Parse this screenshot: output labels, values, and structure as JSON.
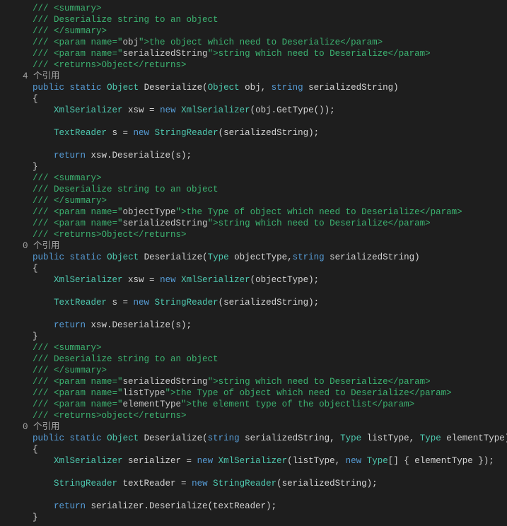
{
  "m1": {
    "c1": "/// <summary>",
    "c2": "/// Deserialize string to an object",
    "c3": "/// </summary>",
    "c4a": "/// <param name=\"",
    "c4p": "obj",
    "c4b": "\">the object which need to Deserialize</param>",
    "c5a": "/// <param name=\"",
    "c5p": "serializedString",
    "c5b": "\">string which need to Deserialize</param>",
    "c6": "/// <returns>Object</returns>",
    "lens": "4 个引用",
    "kw_public": "public",
    "kw_static": "static",
    "type_obj": "Object",
    "mname": " Deserialize(",
    "type_obj2": "Object",
    "p1": " obj, ",
    "type_str": "string",
    "p2": " serializedString)",
    "brace_o": "{",
    "l1_type": "XmlSerializer",
    "l1_rest1": " xsw = ",
    "l1_new": "new",
    "l1_sp": " ",
    "l1_type2": "XmlSerializer",
    "l1_rest2": "(obj.GetType());",
    "l2_type": "TextReader",
    "l2_rest1": " s = ",
    "l2_new": "new",
    "l2_sp": " ",
    "l2_type2": "StringReader",
    "l2_rest2": "(serializedString);",
    "l3_ret": "return",
    "l3_rest": " xsw.Deserialize(s);",
    "brace_c": "}"
  },
  "m2": {
    "c1": "/// <summary>",
    "c2": "/// Deserialize string to an object",
    "c3": "/// </summary>",
    "c4a": "/// <param name=\"",
    "c4p": "objectType",
    "c4b": "\">the Type of object which need to Deserialize</param>",
    "c5a": "/// <param name=\"",
    "c5p": "serializedString",
    "c5b": "\">string which need to Deserialize</param>",
    "c6": "/// <returns>Object</returns>",
    "lens": "0 个引用",
    "kw_public": "public",
    "kw_static": "static",
    "type_obj": "Object",
    "mname": " Deserialize(",
    "type_t": "Type",
    "p1": " objectType,",
    "type_str": "string",
    "p2": " serializedString)",
    "brace_o": "{",
    "l1_type": "XmlSerializer",
    "l1_rest1": " xsw = ",
    "l1_new": "new",
    "l1_sp": " ",
    "l1_type2": "XmlSerializer",
    "l1_rest2": "(objectType);",
    "l2_type": "TextReader",
    "l2_rest1": " s = ",
    "l2_new": "new",
    "l2_sp": " ",
    "l2_type2": "StringReader",
    "l2_rest2": "(serializedString);",
    "l3_ret": "return",
    "l3_rest": " xsw.Deserialize(s);",
    "brace_c": "}"
  },
  "m3": {
    "c1": "/// <summary>",
    "c2": "/// Deserialize string to an object",
    "c3": "/// </summary>",
    "c4a": "/// <param name=\"",
    "c4p": "serializedString",
    "c4b": "\">string which need to Deserialize</param>",
    "c5a": "/// <param name=\"",
    "c5p": "listType",
    "c5b": "\">the Type of object which need to Deserialize</param>",
    "c6a": "/// <param name=\"",
    "c6p": "elementType",
    "c6b": "\">the element type of the objectlist</param>",
    "c7": "/// <returns>object</returns>",
    "lens": "0 个引用",
    "kw_public": "public",
    "kw_static": "static",
    "type_obj": "Object",
    "mname": " Deserialize(",
    "type_str": "string",
    "p1": " serializedString, ",
    "type_t1": "Type",
    "p2": " listType, ",
    "type_t2": "Type",
    "p3": " elementType)",
    "brace_o": "{",
    "l1_type": "XmlSerializer",
    "l1_rest1": " serializer = ",
    "l1_new": "new",
    "l1_sp": " ",
    "l1_type2": "XmlSerializer",
    "l1_rest2a": "(listType, ",
    "l1_new2": "new",
    "l1_sp2": " ",
    "l1_type3": "Type",
    "l1_rest2b": "[] { elementType });",
    "l2_type": "StringReader",
    "l2_rest1": " textReader = ",
    "l2_new": "new",
    "l2_sp": " ",
    "l2_type2": "StringReader",
    "l2_rest2": "(serializedString);",
    "l3_ret": "return",
    "l3_rest": " serializer.Deserialize(textReader);",
    "brace_c": "}"
  }
}
